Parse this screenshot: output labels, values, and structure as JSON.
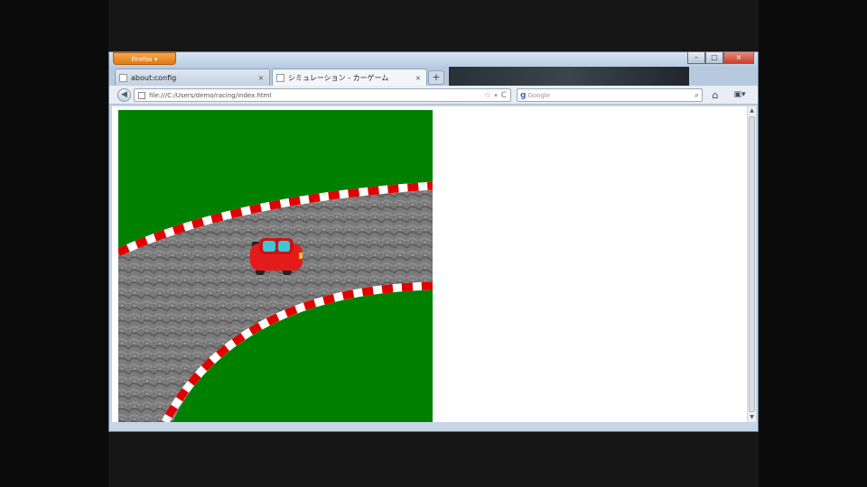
{
  "browser": {
    "app_menu_label": "Firefox",
    "tabs": [
      {
        "label": "about:config"
      },
      {
        "label": "シミュレーション - カーゲーム"
      }
    ],
    "new_tab_label": "+",
    "tab_close_glyph": "×",
    "url": "file:///C:/Users/demo/racing/index.html",
    "search_placeholder": "Google",
    "back_glyph": "◀",
    "star_glyph": "☆",
    "dropdown_glyph": "▾",
    "reload_glyph": "C",
    "search_glyph": "⌕",
    "home_glyph": "⌂",
    "panel_glyph": "▣▾",
    "window_controls": {
      "minimize": "–",
      "maximize": "□",
      "close": "×"
    }
  },
  "game": {
    "colors": {
      "grass": "#008000",
      "asphalt": "#7b7b7b",
      "curb_red": "#e00000",
      "curb_white": "#ffffff",
      "car_body": "#e51b1b",
      "car_glass": "#3ec6d2",
      "car_wheels": "#222222"
    },
    "car": {
      "heading": "right"
    }
  },
  "icons": {
    "back": "back-arrow-icon",
    "home": "home-icon",
    "search": "search-icon",
    "bookmark": "star-icon",
    "reload": "reload-icon"
  }
}
